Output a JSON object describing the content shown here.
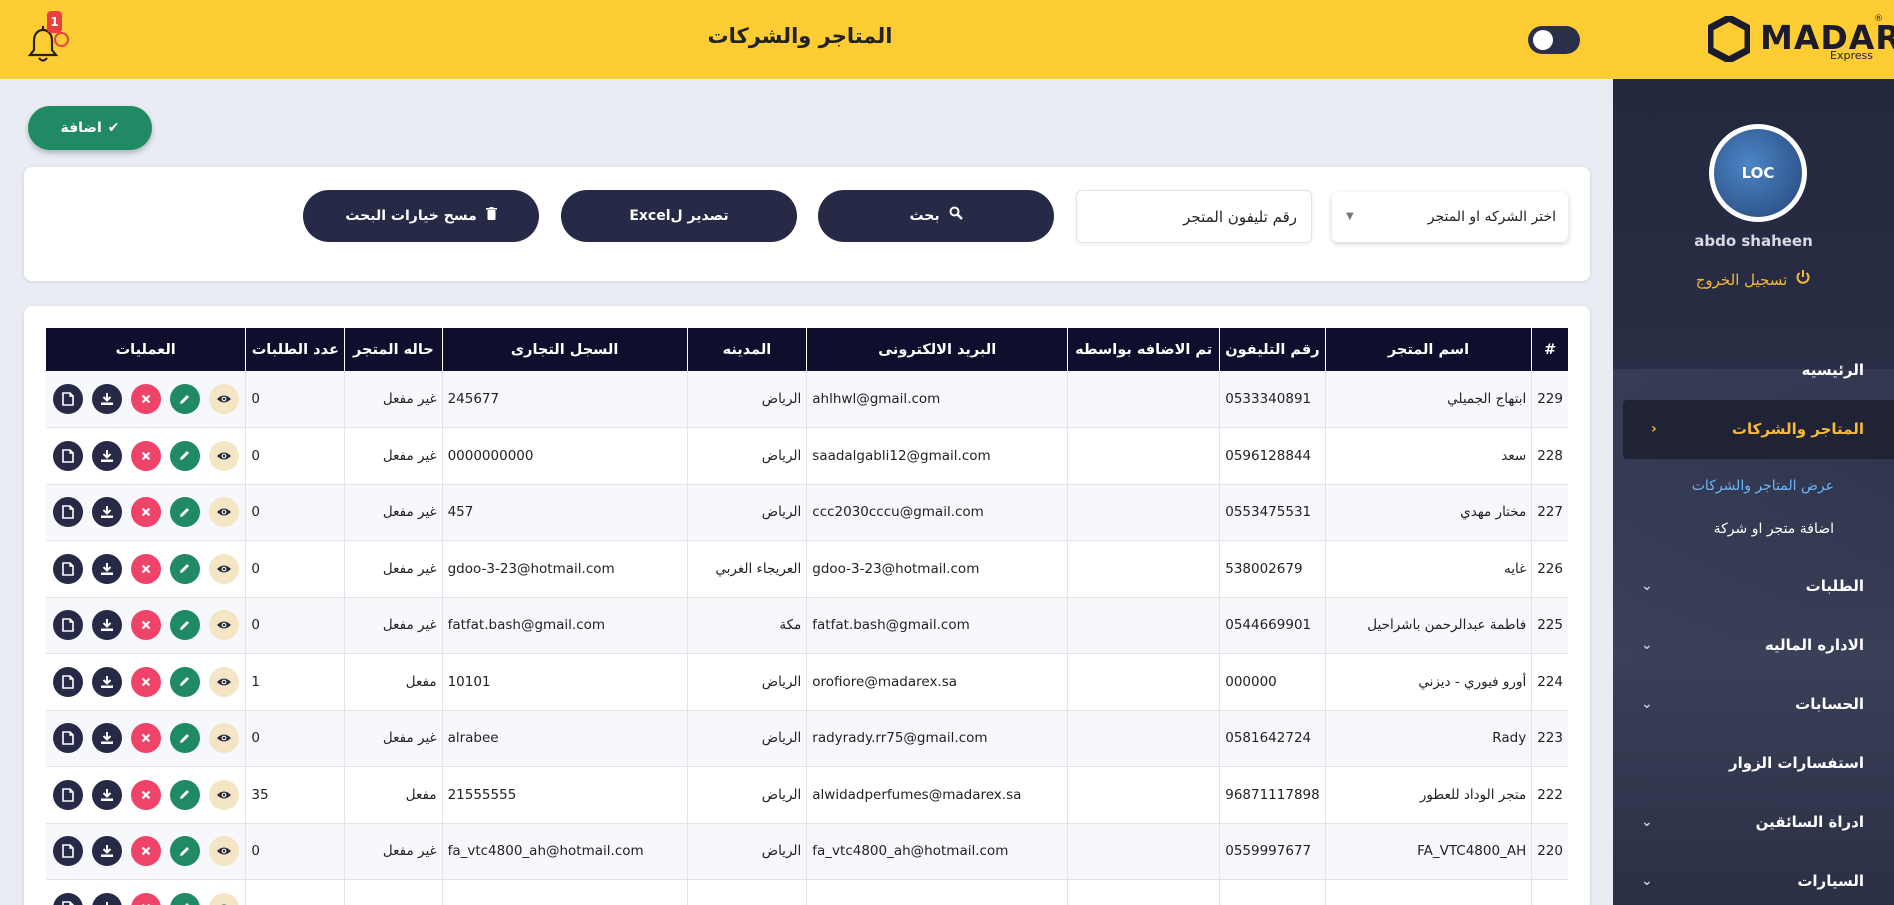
{
  "header": {
    "title": "المتاجر والشركات",
    "notifications_count": "1",
    "logo_text": "MADAR",
    "logo_sub": "Express",
    "logo_reg": "®"
  },
  "sidebar": {
    "user_name": "abdo shaheen",
    "avatar_text": "LOC",
    "logout_label": "تسجيل الخروج",
    "items": [
      {
        "label": "الرئيسيه"
      },
      {
        "label": "المتاجر والشركات"
      },
      {
        "label": "الطلبات"
      },
      {
        "label": "الاداره الماليه"
      },
      {
        "label": "الحسابات"
      },
      {
        "label": "استفسارات الزوار"
      },
      {
        "label": "ادراة السائقين"
      },
      {
        "label": "السيارات"
      }
    ],
    "subitems": [
      {
        "label": "عرض المتاجر والشركات"
      },
      {
        "label": "اضافة متجر او شركة"
      }
    ]
  },
  "toolbar": {
    "add_label": "اضافة"
  },
  "filters": {
    "select_value": "اختر الشركه او المتجر",
    "phone_placeholder": "رقم تليفون المتجر",
    "search_label": "بحث",
    "export_label": "تصدير لExcel",
    "clear_label": "مسح خيارات البحث"
  },
  "table": {
    "headers": [
      "#",
      "اسم المتجر",
      "رقم التليفون",
      "تم الاضافه بواسطه",
      "البريد الالكترونى",
      "المدينه",
      "السجل التجارى",
      "حاله المتجر",
      "عدد الطلبات",
      "العمليات"
    ],
    "rows": [
      {
        "id": "229",
        "name": "ابتهاج الجميلي",
        "phone": "0533340891",
        "added_by": "",
        "email": "ahlhwl@gmail.com",
        "city": "الرياض",
        "reg": "245677",
        "status": "غير مفعل",
        "orders": "0"
      },
      {
        "id": "228",
        "name": "سعد",
        "phone": "0596128844",
        "added_by": "",
        "email": "saadalgabli12@gmail.com",
        "city": "الرياض",
        "reg": "0000000000",
        "status": "غير مفعل",
        "orders": "0"
      },
      {
        "id": "227",
        "name": "مختار مهدي",
        "phone": "0553475531",
        "added_by": "",
        "email": "ccc2030cccu@gmail.com",
        "city": "الرياض",
        "reg": "457",
        "status": "غير مفعل",
        "orders": "0"
      },
      {
        "id": "226",
        "name": "غايه",
        "phone": "538002679",
        "added_by": "",
        "email": "gdoo-3-23@hotmail.com",
        "city": "العريجاء الغربي",
        "reg": "gdoo-3-23@hotmail.com",
        "status": "غير مفعل",
        "orders": "0"
      },
      {
        "id": "225",
        "name": "فاطمة عبدالرحمن باشراحيل",
        "phone": "0544669901",
        "added_by": "",
        "email": "fatfat.bash@gmail.com",
        "city": "مكة",
        "reg": "fatfat.bash@gmail.com",
        "status": "غير مفعل",
        "orders": "0"
      },
      {
        "id": "224",
        "name": "أورو فيوري - ديزني",
        "phone": "000000",
        "added_by": "",
        "email": "orofiore@madarex.sa",
        "city": "الرياض",
        "reg": "10101",
        "status": "مفعل",
        "orders": "1"
      },
      {
        "id": "223",
        "name": "Rady",
        "phone": "0581642724",
        "added_by": "",
        "email": "radyrady.rr75@gmail.com",
        "city": "الرياض",
        "reg": "alrabee",
        "status": "غير مفعل",
        "orders": "0"
      },
      {
        "id": "222",
        "name": "متجر الوداد للعطور",
        "phone": "96871117898",
        "added_by": "",
        "email": "alwidadperfumes@madarex.sa",
        "city": "الرياض",
        "reg": "21555555",
        "status": "مفعل",
        "orders": "35"
      },
      {
        "id": "220",
        "name": "FA_VTC4800_AH",
        "phone": "0559997677",
        "added_by": "",
        "email": "fa_vtc4800_ah@hotmail.com",
        "city": "الرياض",
        "reg": "fa_vtc4800_ah@hotmail.com",
        "status": "غير مفعل",
        "orders": "0"
      },
      {
        "id": "",
        "name": "",
        "phone": "",
        "added_by": "",
        "email": "",
        "city": "",
        "reg": "",
        "status": "",
        "orders": ""
      }
    ]
  },
  "colors": {
    "header_bg": "#fecd34",
    "sidebar_bg": "#24283d",
    "accent_gold": "#f5b93b",
    "primary_dark": "#262a46",
    "success": "#1f8a63",
    "danger": "#f0436a",
    "link_blue": "#6fb5f3"
  }
}
